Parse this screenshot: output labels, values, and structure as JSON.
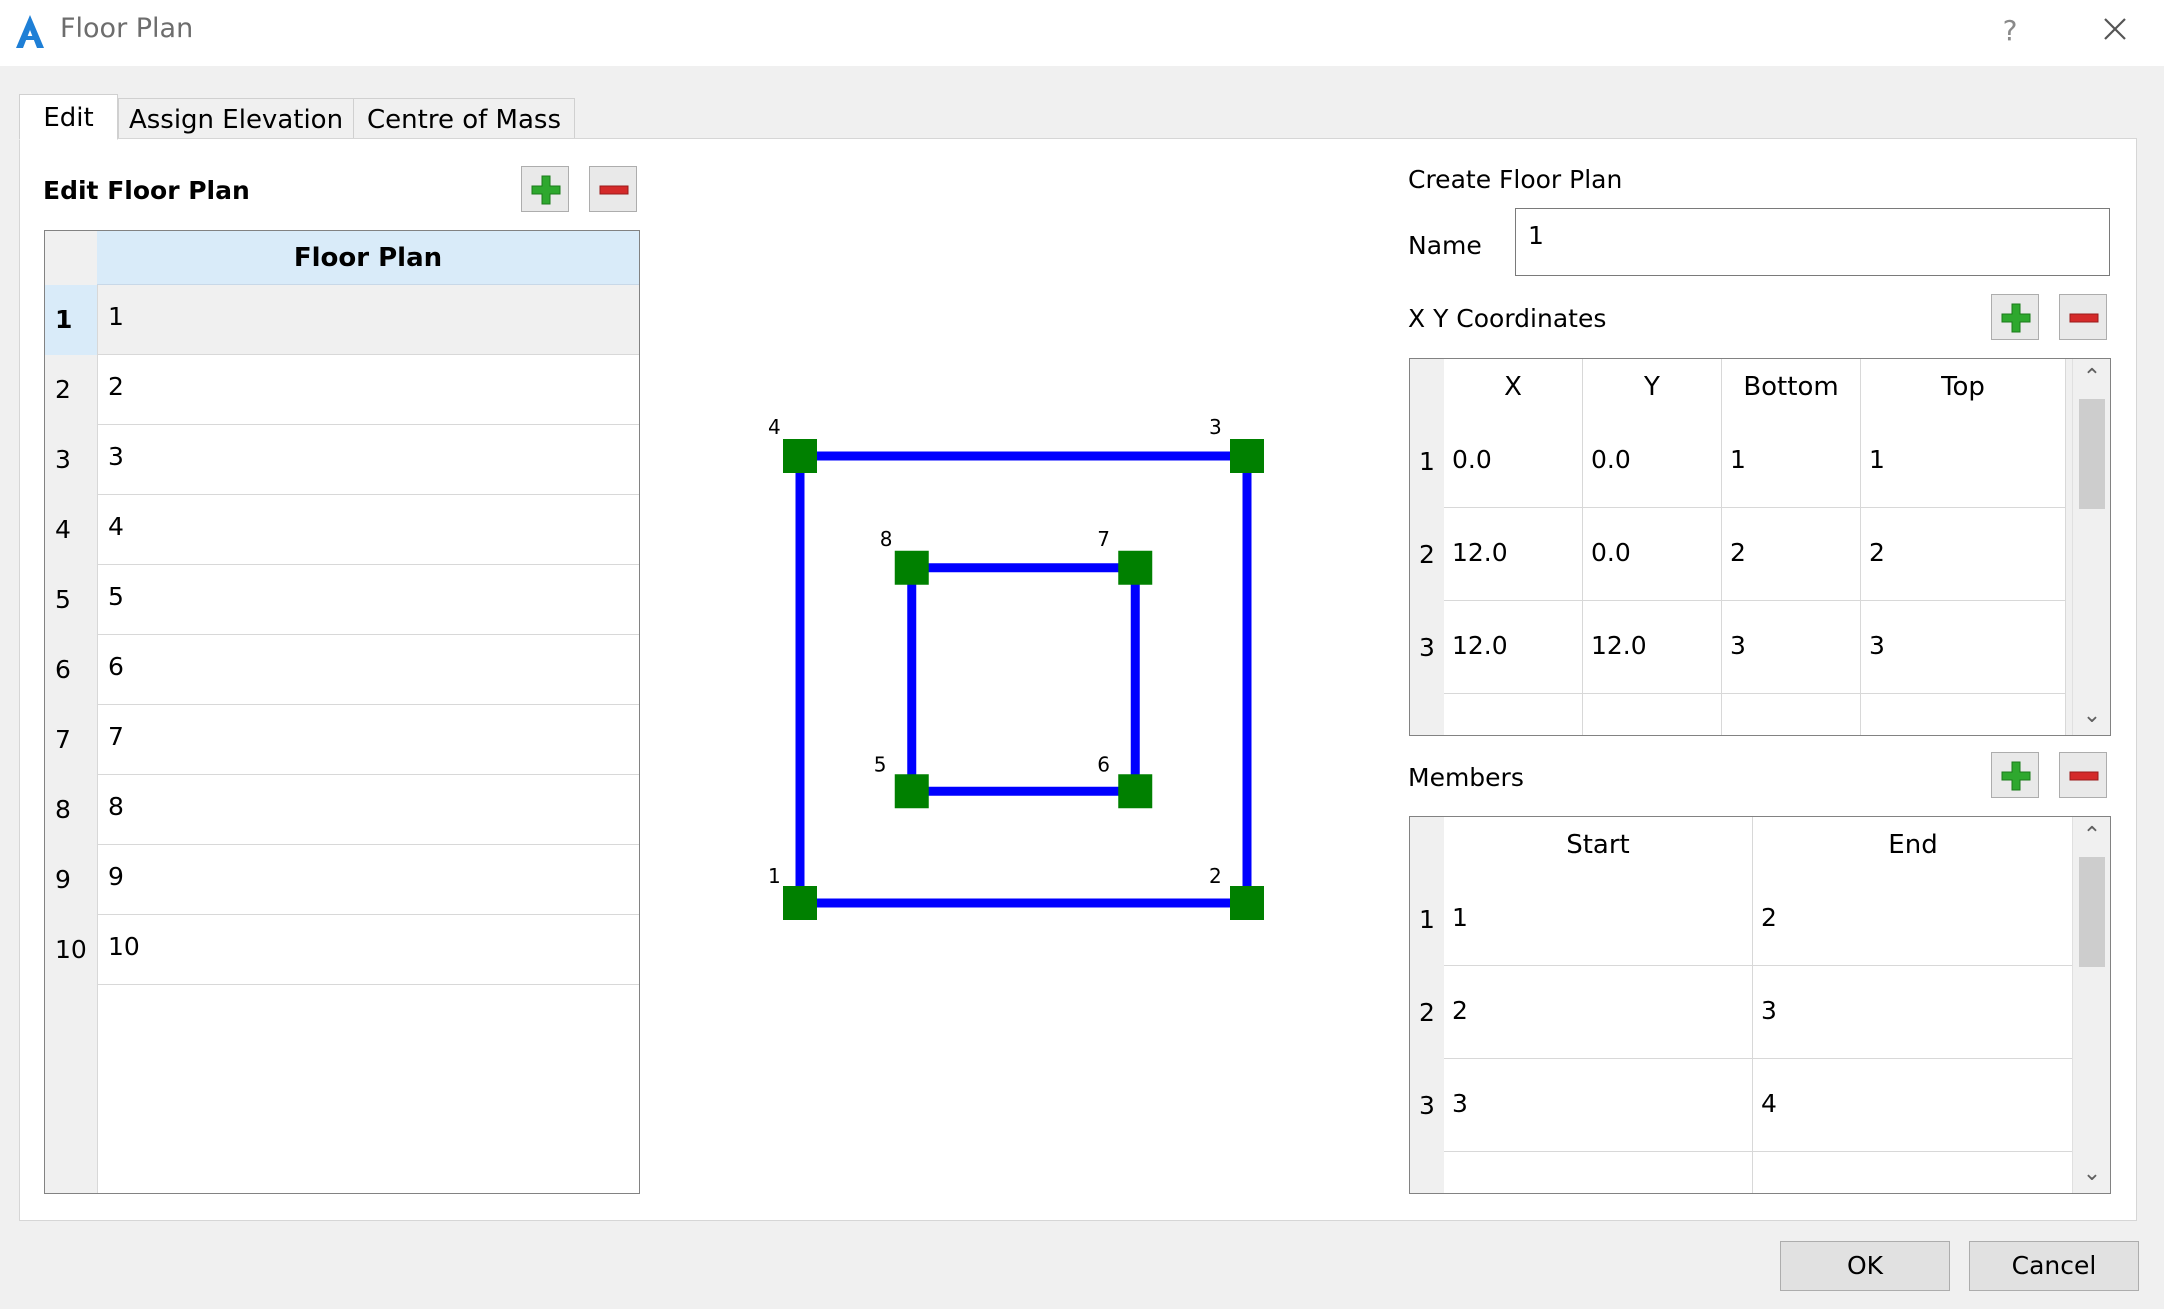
{
  "window": {
    "title": "Floor Plan",
    "help_label": "?"
  },
  "tabs": [
    {
      "label": "Edit",
      "active": true
    },
    {
      "label": "Assign Elevation",
      "active": false
    },
    {
      "label": "Centre of Mass",
      "active": false
    }
  ],
  "edit_floor_plan": {
    "heading": "Edit Floor Plan",
    "column_header": "Floor Plan",
    "selected_row": 1,
    "rows": [
      {
        "num": "1",
        "value": "1"
      },
      {
        "num": "2",
        "value": "2"
      },
      {
        "num": "3",
        "value": "3"
      },
      {
        "num": "4",
        "value": "4"
      },
      {
        "num": "5",
        "value": "5"
      },
      {
        "num": "6",
        "value": "6"
      },
      {
        "num": "7",
        "value": "7"
      },
      {
        "num": "8",
        "value": "8"
      },
      {
        "num": "9",
        "value": "9"
      },
      {
        "num": "10",
        "value": "10"
      }
    ]
  },
  "plan_view": {
    "line_color": "#0000ff",
    "node_color": "#008000",
    "nodes": [
      {
        "label": "1",
        "x": 0.0,
        "y": 0.0
      },
      {
        "label": "2",
        "x": 12.0,
        "y": 0.0
      },
      {
        "label": "3",
        "x": 12.0,
        "y": 12.0
      },
      {
        "label": "4",
        "x": 0.0,
        "y": 12.0
      },
      {
        "label": "5",
        "x": 3.0,
        "y": 3.0
      },
      {
        "label": "6",
        "x": 9.0,
        "y": 3.0
      },
      {
        "label": "7",
        "x": 9.0,
        "y": 9.0
      },
      {
        "label": "8",
        "x": 3.0,
        "y": 9.0
      }
    ],
    "members": [
      [
        1,
        2
      ],
      [
        2,
        3
      ],
      [
        3,
        4
      ],
      [
        4,
        1
      ],
      [
        5,
        6
      ],
      [
        6,
        7
      ],
      [
        7,
        8
      ],
      [
        8,
        5
      ]
    ]
  },
  "create_floor_plan": {
    "heading": "Create Floor Plan",
    "name_label": "Name",
    "name_value": "1",
    "coords_label": "X Y Coordinates",
    "coords_headers": [
      "X",
      "Y",
      "Bottom",
      "Top"
    ],
    "coords_rows": [
      {
        "num": "1",
        "cells": [
          "0.0",
          "0.0",
          "1",
          "1"
        ]
      },
      {
        "num": "2",
        "cells": [
          "12.0",
          "0.0",
          "2",
          "2"
        ]
      },
      {
        "num": "3",
        "cells": [
          "12.0",
          "12.0",
          "3",
          "3"
        ]
      }
    ],
    "members_label": "Members",
    "members_headers": [
      "Start",
      "End"
    ],
    "members_rows": [
      {
        "num": "1",
        "cells": [
          "1",
          "2"
        ]
      },
      {
        "num": "2",
        "cells": [
          "2",
          "3"
        ]
      },
      {
        "num": "3",
        "cells": [
          "3",
          "4"
        ]
      }
    ]
  },
  "icons": {
    "add": "plus-icon",
    "remove": "minus-icon",
    "scroll_up": "chevron-up-icon",
    "scroll_down": "chevron-down-icon"
  },
  "buttons": {
    "ok": "OK",
    "cancel": "Cancel"
  }
}
